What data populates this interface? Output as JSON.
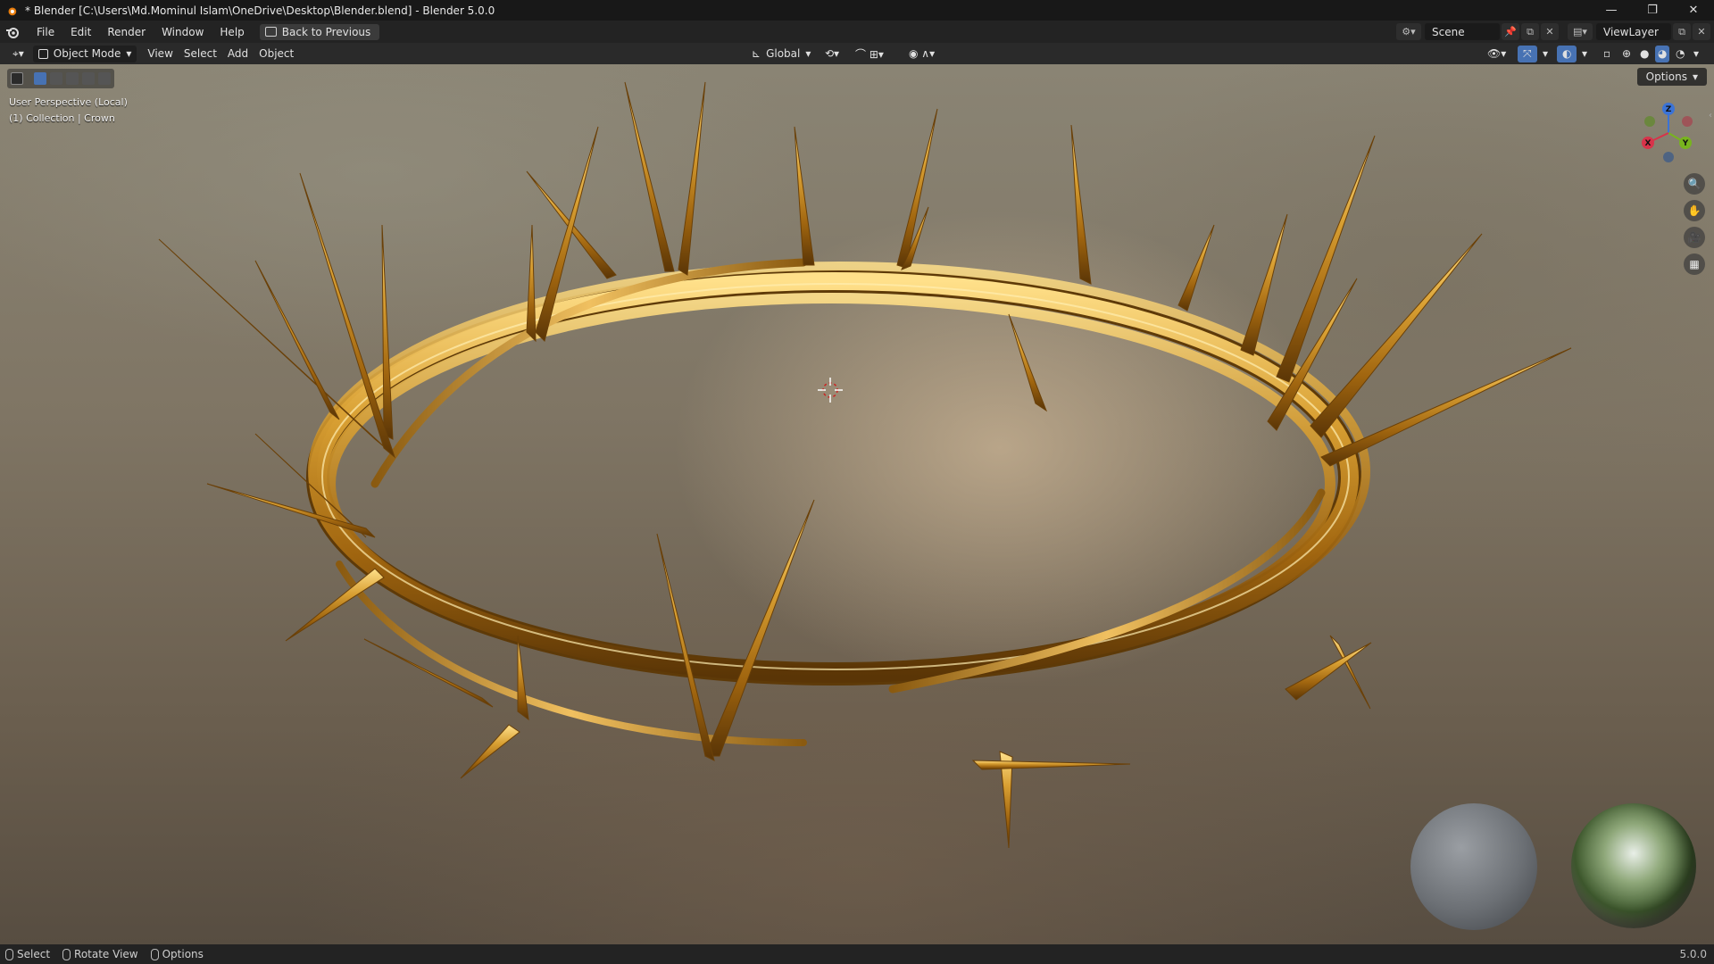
{
  "window": {
    "title": "* Blender [C:\\Users\\Md.Mominul Islam\\OneDrive\\Desktop\\Blender.blend] - Blender 5.0.0",
    "controls": [
      "—",
      "❐",
      "✕"
    ]
  },
  "menubar": {
    "items": [
      "File",
      "Edit",
      "Render",
      "Window",
      "Help"
    ],
    "back_button": "Back to Previous",
    "scene_name": "Scene",
    "view_layer": "ViewLayer"
  },
  "viewport_header": {
    "mode": "Object Mode",
    "menus": [
      "View",
      "Select",
      "Add",
      "Object"
    ],
    "orientation": "Global"
  },
  "viewport": {
    "perspective_label": "User Perspective (Local)",
    "collection_label": "(1) Collection | Crown",
    "options_label": "Options",
    "gizmo": {
      "x": "X",
      "y": "Y",
      "z": "Z"
    },
    "colors": {
      "gold": "#c98a1c",
      "gold_highlight": "#ffe08a",
      "gold_shadow": "#6e4208"
    }
  },
  "statusbar": {
    "select": "Select",
    "rotate": "Rotate View",
    "options": "Options",
    "version": "5.0.0"
  }
}
